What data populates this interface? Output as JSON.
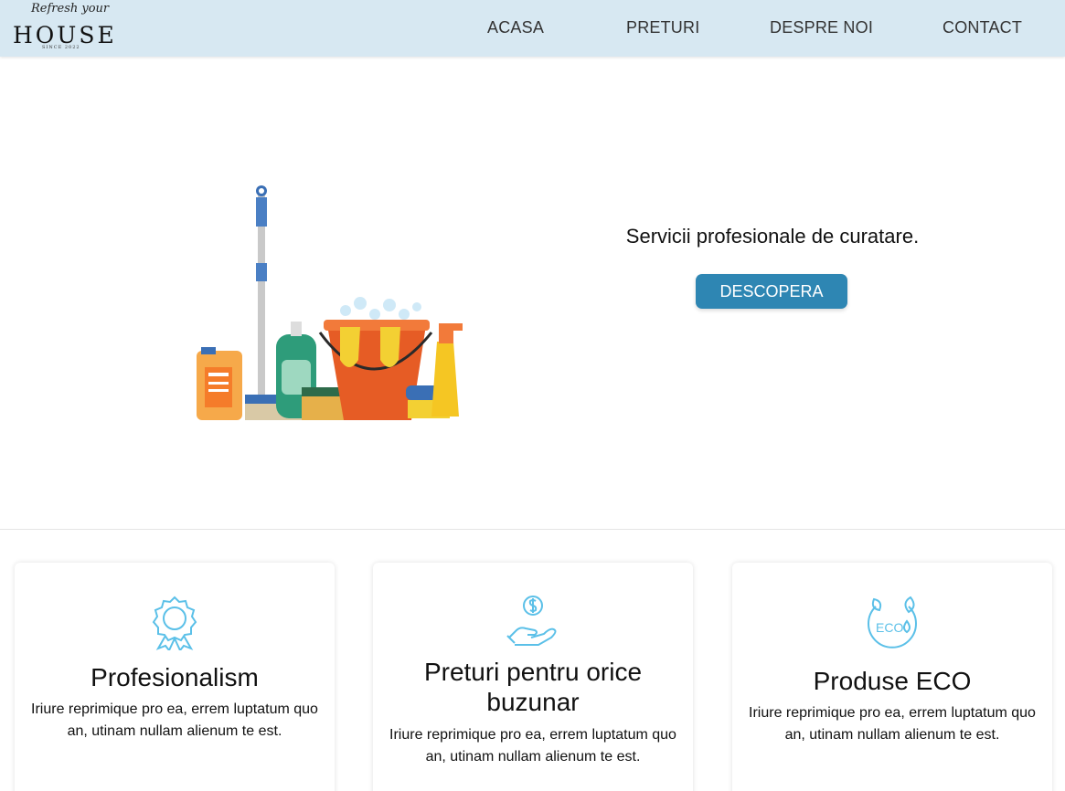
{
  "header": {
    "logo": {
      "script": "Refresh your",
      "word": "HOUSE",
      "since": "SINCE 2022"
    },
    "nav": [
      "ACASA",
      "PRETURI",
      "DESPRE NOI",
      "CONTACT"
    ]
  },
  "hero": {
    "tagline": "Servicii profesionale de curatare.",
    "button_label": "DESCOPERA",
    "image_icon": "cleaning-supplies-illustration"
  },
  "features": [
    {
      "icon": "award-ribbon-icon",
      "title": "Profesionalism",
      "text": "Iriure reprimique pro ea, errem luptatum quo an, utinam nullam alienum te est."
    },
    {
      "icon": "hand-coin-icon",
      "title": "Preturi pentru orice buzunar",
      "text": "Iriure reprimique pro ea, errem luptatum quo an, utinam nullam alienum te est."
    },
    {
      "icon": "eco-leaves-icon",
      "title": "Produse ECO",
      "text": "Iriure reprimique pro ea, errem luptatum quo an, utinam nullam alienum te est.",
      "icon_text": "ECO"
    }
  ],
  "colors": {
    "header_bg": "#d7e8f2",
    "button_bg": "#2e86b3",
    "icon_stroke": "#5bc0e8"
  }
}
